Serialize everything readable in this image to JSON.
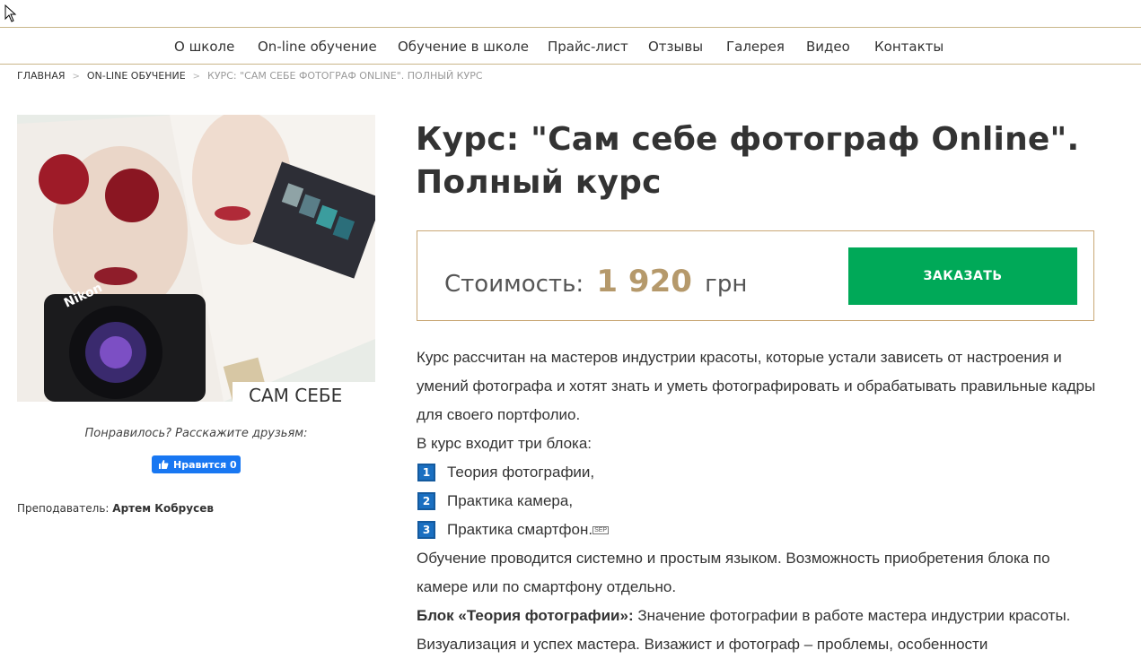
{
  "nav": {
    "items": [
      {
        "label": "О школе"
      },
      {
        "label": "On-line обучение"
      },
      {
        "label": "Обучение в школе"
      },
      {
        "label": "Прайс-лист"
      },
      {
        "label": "Отзывы"
      },
      {
        "label": "Галерея"
      },
      {
        "label": "Видео"
      },
      {
        "label": "Контакты"
      }
    ]
  },
  "breadcrumb": {
    "home": "Главная",
    "section": "On-line обучение",
    "current": "Курс: \"Сам себе фотограф Online\". Полный курс"
  },
  "sidebar": {
    "share_text": "Понравилось? Расскажите друзьям:",
    "like_label": "Нравится 0",
    "teacher_label": "Преподаватель:",
    "teacher_name": "Артем Кобрусев",
    "image_caption": "САМ СЕБЕ"
  },
  "course": {
    "title_line1": "Курс: \"Сам себе фотограф Online\".",
    "title_line2": "Полный курс",
    "price_label": "Стоимость:",
    "price_value": "1 920",
    "price_currency": "грн",
    "order_button": "ЗАКАЗАТЬ"
  },
  "description": {
    "intro": "Курс рассчитан на мастеров индустрии красоты, которые устали зависеть от настроения и умений фотографа и хотят знать и уметь фотографировать и обрабатывать правильные кадры для своего портфолио.",
    "blocks_intro": "В курс входит три блока:",
    "blocks": [
      {
        "num": "1",
        "text": "Теория фотографии,"
      },
      {
        "num": "2",
        "text": "Практика камера,"
      },
      {
        "num": "3",
        "text": "Практика смартфон."
      }
    ],
    "sep_glyph": "SEP",
    "note": "Обучение проводится системно и простым языком. Возможность приобретения блока по камере или по смартфону отдельно.",
    "block_theory_title": "Блок «Теория фотографии»:",
    "block_theory_text": "Значение фотографии в работе мастера индустрии красоты. Визуализация и успех мастера. Визажист и фотограф – проблемы, особенности"
  },
  "colors": {
    "accent_gold": "#b5996b",
    "border_gold": "#c9a876",
    "order_green": "#00a958",
    "facebook_blue": "#1877f2",
    "number_blue": "#1a6fc1"
  }
}
